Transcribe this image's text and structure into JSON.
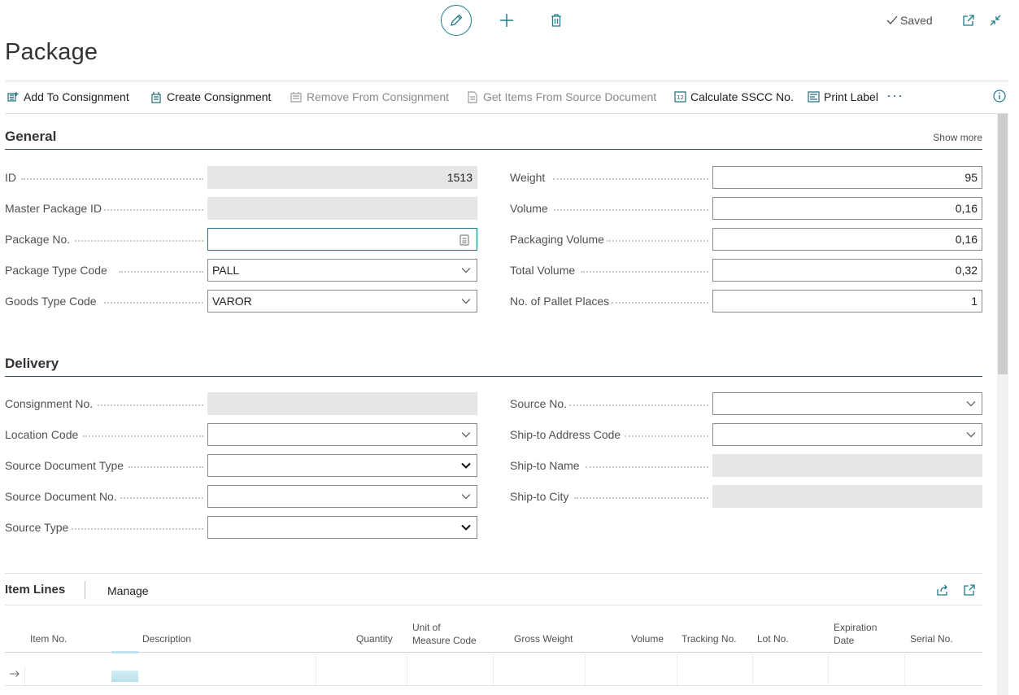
{
  "top_bar": {
    "status": "Saved",
    "icons": [
      "pencil-icon",
      "plus-icon",
      "trash-icon",
      "open-new-window-icon",
      "collapse-icon"
    ]
  },
  "page": {
    "title": "Package"
  },
  "actions": [
    {
      "label": "Add To Consignment",
      "icon": "add-consignment-icon",
      "enabled": true
    },
    {
      "label": "Create Consignment",
      "icon": "create-consignment-icon",
      "enabled": true
    },
    {
      "label": "Remove From Consignment",
      "icon": "remove-consignment-icon",
      "enabled": false
    },
    {
      "label": "Get Items From Source Document",
      "icon": "get-items-icon",
      "enabled": false
    },
    {
      "label": "Calculate SSCC No.",
      "icon": "calculate-icon",
      "enabled": true
    },
    {
      "label": "Print Label",
      "icon": "print-icon",
      "enabled": true
    }
  ],
  "general": {
    "title": "General",
    "show_more": "Show more",
    "fields": {
      "id": {
        "label": "ID",
        "value": "1513"
      },
      "master_package_id": {
        "label": "Master Package ID",
        "value": ""
      },
      "package_no": {
        "label": "Package No.",
        "value": ""
      },
      "package_type_code": {
        "label": "Package Type Code",
        "value": "PALL"
      },
      "goods_type_code": {
        "label": "Goods Type Code",
        "value": "VAROR"
      },
      "weight": {
        "label": "Weight",
        "value": "95"
      },
      "volume": {
        "label": "Volume",
        "value": "0,16"
      },
      "packaging_volume": {
        "label": "Packaging Volume",
        "value": "0,16"
      },
      "total_volume": {
        "label": "Total Volume",
        "value": "0,32"
      },
      "pallet_places": {
        "label": "No. of Pallet Places",
        "value": "1"
      }
    }
  },
  "delivery": {
    "title": "Delivery",
    "fields": {
      "consignment_no": {
        "label": "Consignment No.",
        "value": ""
      },
      "location_code": {
        "label": "Location Code",
        "value": ""
      },
      "source_document_type": {
        "label": "Source Document Type",
        "value": ""
      },
      "source_document_no": {
        "label": "Source Document No.",
        "value": ""
      },
      "source_type": {
        "label": "Source Type",
        "value": ""
      },
      "source_no": {
        "label": "Source No.",
        "value": ""
      },
      "ship_to_address_code": {
        "label": "Ship-to Address Code",
        "value": ""
      },
      "ship_to_name": {
        "label": "Ship-to Name",
        "value": ""
      },
      "ship_to_city": {
        "label": "Ship-to City",
        "value": ""
      }
    }
  },
  "item_lines": {
    "title": "Item Lines",
    "manage": "Manage",
    "columns": {
      "item_no": "Item No.",
      "description": "Description",
      "quantity": "Quantity",
      "uom_line1": "Unit of",
      "uom_line2": "Measure Code",
      "gross_weight": "Gross Weight",
      "volume": "Volume",
      "tracking_no": "Tracking No.",
      "lot_no": "Lot No.",
      "expiration_line1": "Expiration",
      "expiration_line2": "Date",
      "serial_no": "Serial No."
    }
  },
  "colors": {
    "accent": "#1e7a8c",
    "readonly_bg": "#e6e6e6",
    "section_rule": "#3c4b5c"
  }
}
